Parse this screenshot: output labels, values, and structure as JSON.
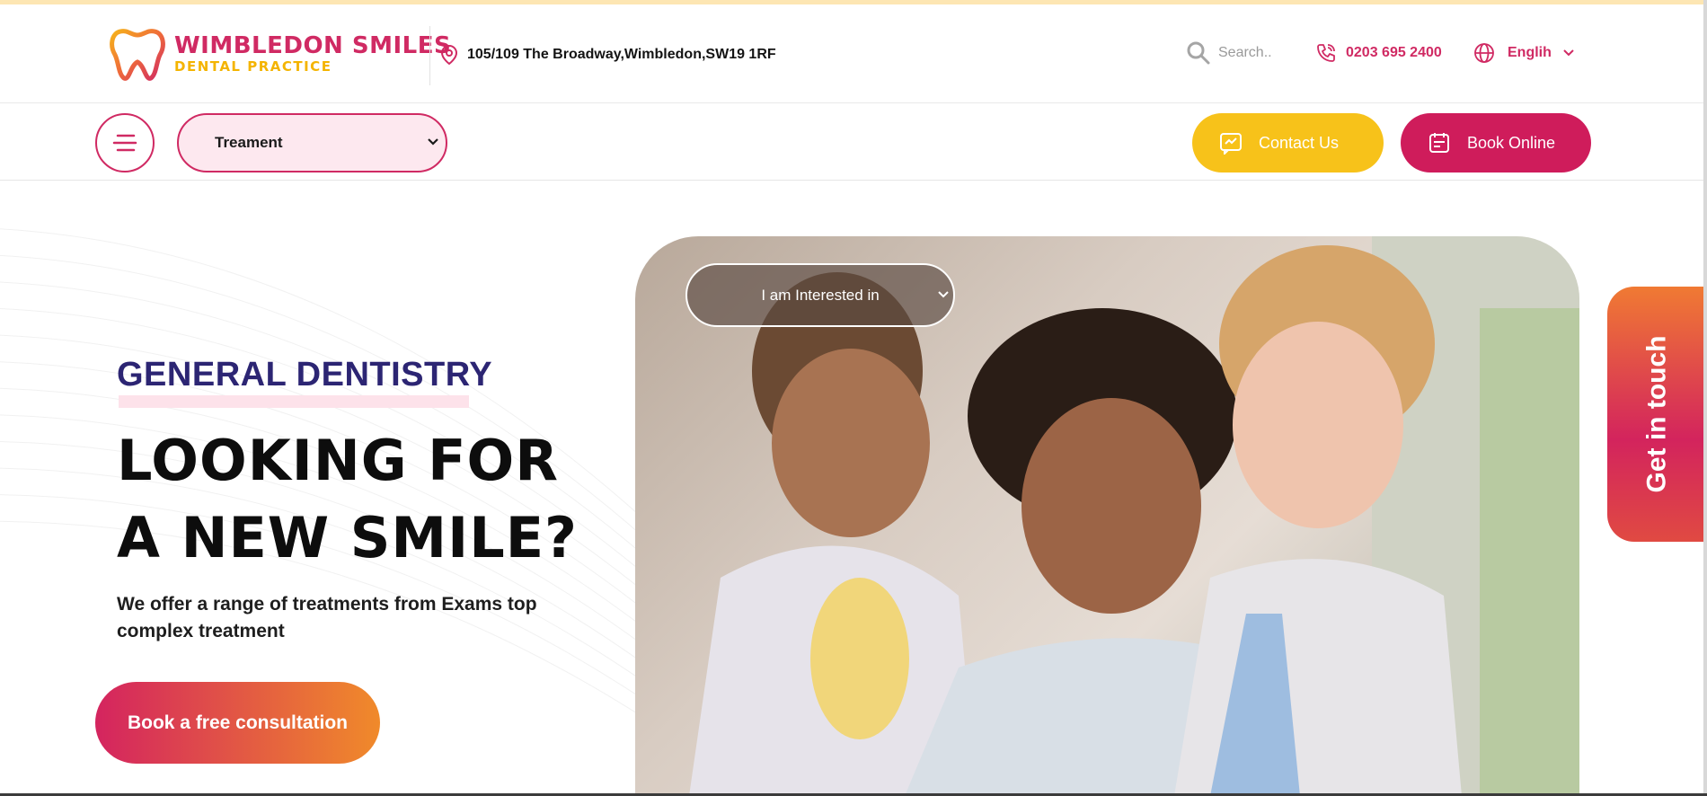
{
  "header": {
    "logo": {
      "title": "WIMBLEDON SMILES",
      "subtitle": "DENTAL PRACTICE"
    },
    "address": "105/109 The Broadway,Wimbledon,SW19 1RF",
    "search": {
      "placeholder": "Search.."
    },
    "phone": "0203 695 2400",
    "language": "Englih"
  },
  "nav": {
    "treatment_select": "Treament",
    "contact_label": "Contact Us",
    "book_label": "Book Online"
  },
  "hero": {
    "eyebrow": "GENERAL DENTISTRY",
    "headline_line1": "LOOKING FOR",
    "headline_line2": "A NEW SMILE?",
    "description": "We offer a range of treatments from Exams top complex treatment",
    "cta_label": "Book a free consultation",
    "interest_select": "I am Interested in"
  },
  "side_tab": {
    "label": "Get in touch"
  },
  "colors": {
    "brand_pink": "#d02a63",
    "brand_yellow": "#f7c21a",
    "navy": "#2c2573",
    "cta_gradient_start": "#d4245f",
    "cta_gradient_end": "#f08a2a"
  }
}
